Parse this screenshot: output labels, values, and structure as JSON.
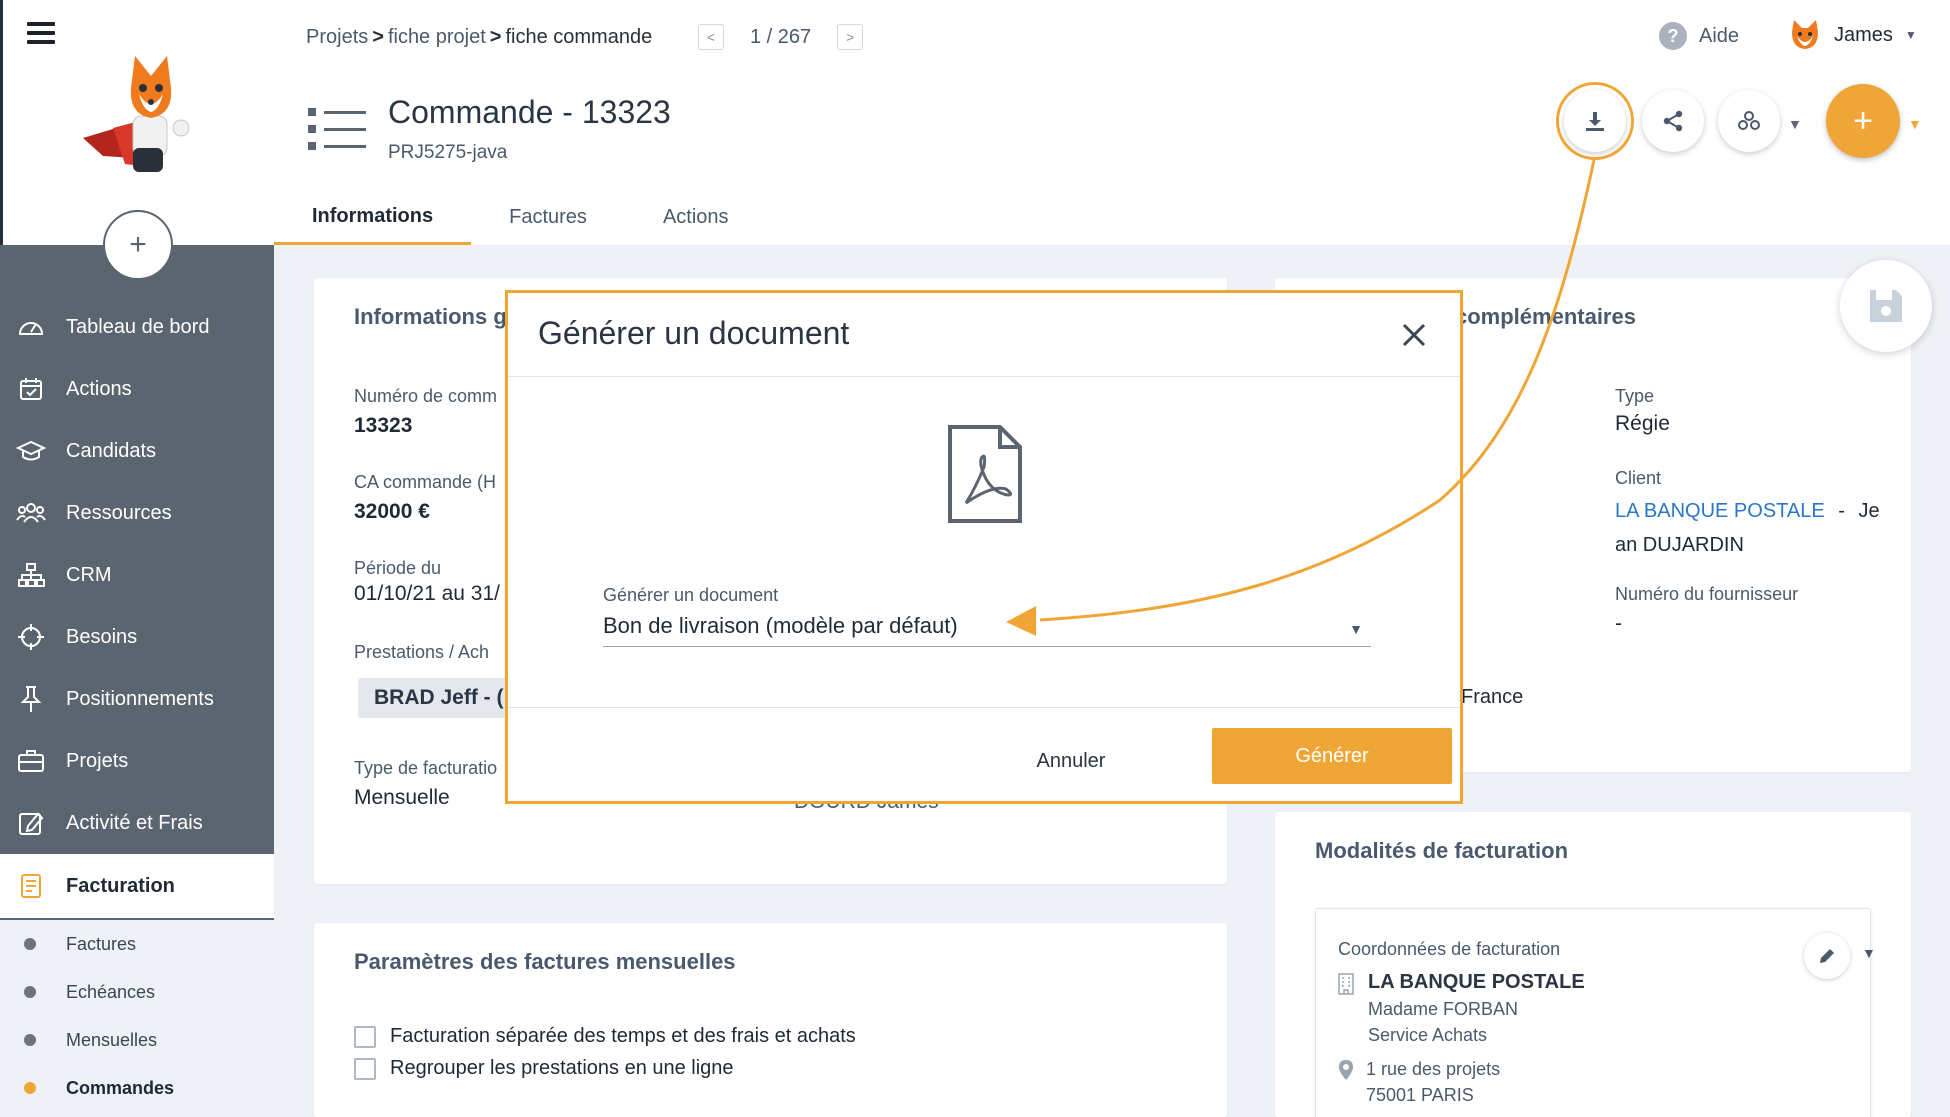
{
  "breadcrumb": {
    "crumb1": "Projets",
    "crumb2": "fiche projet",
    "crumb3": "fiche commande",
    "sep": ">"
  },
  "pager": {
    "text": "1 / 267",
    "prev": "<",
    "next": ">"
  },
  "help": {
    "label": "Aide",
    "icon": "?"
  },
  "user": {
    "name": "James"
  },
  "page": {
    "title": "Commande - 13323",
    "subtitle": "PRJ5275-java"
  },
  "tabs": [
    {
      "label": "Informations"
    },
    {
      "label": "Factures"
    },
    {
      "label": "Actions"
    }
  ],
  "sidebar": {
    "add_label": "+",
    "items": [
      {
        "label": "Tableau de bord",
        "icon": "dashboard-icon"
      },
      {
        "label": "Actions",
        "icon": "calendar-check-icon"
      },
      {
        "label": "Candidats",
        "icon": "graduation-cap-icon"
      },
      {
        "label": "Ressources",
        "icon": "users-icon"
      },
      {
        "label": "CRM",
        "icon": "sitemap-icon"
      },
      {
        "label": "Besoins",
        "icon": "crosshair-icon"
      },
      {
        "label": "Positionnements",
        "icon": "pin-icon"
      },
      {
        "label": "Projets",
        "icon": "briefcase-icon"
      },
      {
        "label": "Activité et Frais",
        "icon": "edit-icon"
      },
      {
        "label": "Facturation",
        "icon": "invoice-icon"
      }
    ],
    "subitems": [
      {
        "label": "Factures"
      },
      {
        "label": "Echéances"
      },
      {
        "label": "Mensuelles"
      },
      {
        "label": "Commandes"
      }
    ]
  },
  "info_card": {
    "title": "Informations g",
    "order_number_label": "Numéro de comm",
    "order_number_value": "13323",
    "ca_label": "CA commande (H",
    "ca_value": "32000 €",
    "period_label": "Période du",
    "period_value": "01/10/21 au 31/",
    "prestations_label": "Prestations / Ach",
    "chip_value": "BRAD Jeff - (",
    "billing_type_label": "Type de facturatio",
    "billing_type_value": "Mensuelle",
    "hidden_value": "DOURD James"
  },
  "comp_card": {
    "title": "complémentaires",
    "type_label": "Type",
    "type_value": "Régie",
    "client_label": "Client",
    "client_link": "LA BANQUE POSTALE",
    "client_sep": "-",
    "client_contact_a": "Je",
    "client_contact_b": "an DUJARDIN",
    "supplier_label": "Numéro du fournisseur",
    "supplier_value": "-",
    "country_value": "France"
  },
  "params_card": {
    "title": "Paramètres des factures mensuelles",
    "check1": "Facturation séparée des temps et des frais et achats",
    "check2": "Regrouper les prestations en une ligne"
  },
  "modal_card": {
    "title": "Modalités de facturation",
    "billing_label": "Coordonnées de facturation",
    "company": "LA BANQUE POSTALE",
    "contact": "Madame FORBAN",
    "service": "Service Achats",
    "address1": "1 rue des projets",
    "address2": "75001 PARIS"
  },
  "dialog": {
    "title": "Générer un document",
    "field_label": "Générer un document",
    "selected_value": "Bon de livraison (modèle par défaut)",
    "cancel_label": "Annuler",
    "generate_label": "Générer"
  },
  "colors": {
    "accent": "#f0a637",
    "sidebar": "#5b6570",
    "link": "#2a76c8",
    "text": "#1f2a36"
  }
}
